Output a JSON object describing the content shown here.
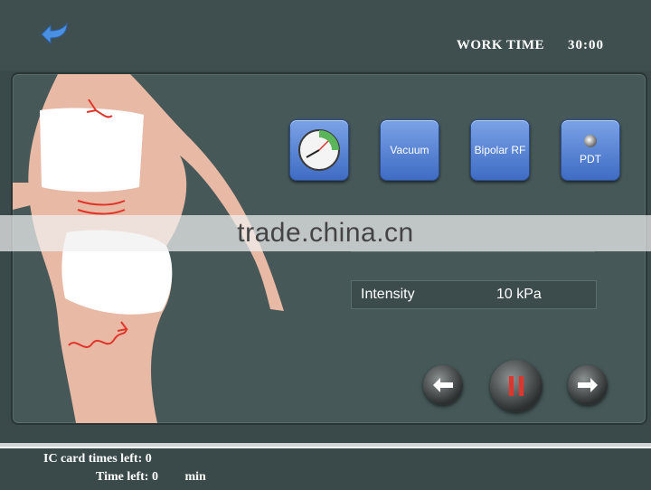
{
  "header": {
    "work_time_label": "WORK TIME",
    "work_time_value": "30:00"
  },
  "modes": [
    {
      "label": ""
    },
    {
      "label": "Vacuum"
    },
    {
      "label": "Bipolar RF"
    },
    {
      "label": "PDT"
    }
  ],
  "readout": {
    "label": "Intensity",
    "value": "10 kPa"
  },
  "watermark": "trade.china.cn",
  "status": {
    "ic_label": "IC card times left:",
    "ic_value": "0",
    "time_label": "Time left:",
    "time_value": "0",
    "time_unit": "min"
  },
  "colors": {
    "button_blue": "#4f7fd6",
    "panel": "#465858",
    "arrow_red": "#e0352b"
  }
}
